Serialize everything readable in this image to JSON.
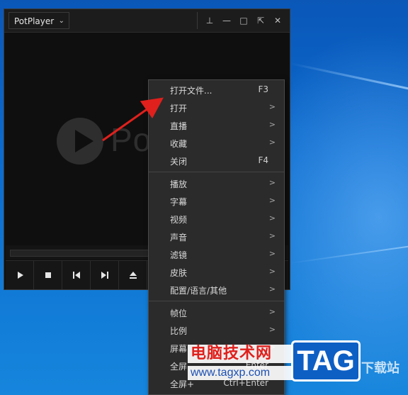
{
  "player": {
    "app_menu_label": "PotPlayer",
    "logo_text": "Pot",
    "title_buttons": [
      "pin",
      "minimize",
      "maximize",
      "fullscreen",
      "close"
    ],
    "controls": [
      "play",
      "stop",
      "previous",
      "next",
      "eject"
    ]
  },
  "menu": {
    "items": [
      {
        "label": "打开文件...",
        "shortcut": "F3",
        "submenu": false
      },
      {
        "label": "打开",
        "shortcut": "",
        "submenu": true
      },
      {
        "label": "直播",
        "shortcut": "",
        "submenu": true
      },
      {
        "label": "收藏",
        "shortcut": "",
        "submenu": true
      },
      {
        "label": "关闭",
        "shortcut": "F4",
        "submenu": false
      },
      {
        "label": "播放",
        "shortcut": "",
        "submenu": true
      },
      {
        "label": "字幕",
        "shortcut": "",
        "submenu": true
      },
      {
        "label": "视频",
        "shortcut": "",
        "submenu": true
      },
      {
        "label": "声音",
        "shortcut": "",
        "submenu": true
      },
      {
        "label": "滤镜",
        "shortcut": "",
        "submenu": true
      },
      {
        "label": "皮肤",
        "shortcut": "",
        "submenu": true
      },
      {
        "label": "配置/语言/其他",
        "shortcut": "",
        "submenu": true
      },
      {
        "label": "帧位",
        "shortcut": "",
        "submenu": true
      },
      {
        "label": "比例",
        "shortcut": "",
        "submenu": true
      },
      {
        "label": "屏幕",
        "shortcut": "",
        "submenu": true
      },
      {
        "label": "全屏",
        "shortcut": "Enter",
        "submenu": false
      },
      {
        "label": "全屏+",
        "shortcut": "Ctrl+Enter",
        "submenu": false
      }
    ],
    "arrow_glyph": ">"
  },
  "watermark": {
    "title": "电脑技术网",
    "url": "www.tagxp.com",
    "tag": "TAG",
    "side_text": "下载站"
  },
  "colors": {
    "desktop": "#0b6ccf",
    "menu_bg": "#2b2b2b",
    "pointer_arrow": "#e0201c"
  }
}
